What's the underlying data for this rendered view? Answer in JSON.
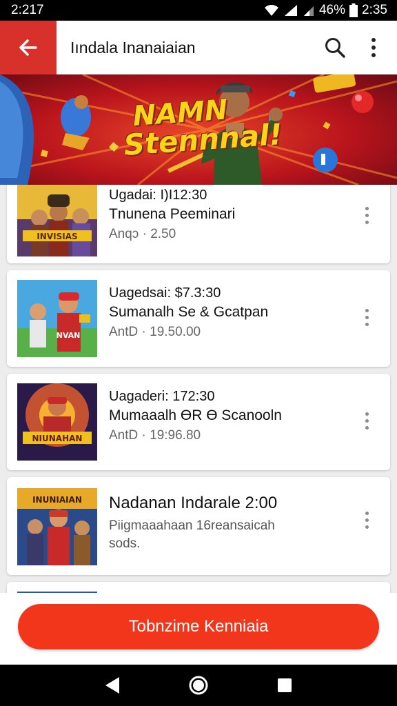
{
  "status_bar": {
    "time_left": "2:217",
    "battery": "46%",
    "time_right": "2:35"
  },
  "app_bar": {
    "title": "Iındala Inanaiaian",
    "icons": [
      "back-arrow-icon",
      "search-icon",
      "more-vert-icon"
    ]
  },
  "banner": {
    "title_line1": "NAMN",
    "title_line2": "Stennnal!"
  },
  "cards": [
    {
      "thumb_text": "INVISIAS",
      "line1": "Ugadai: I)I12:30",
      "line2": "Tnunena Peeminari",
      "line3": "Anqɔ · 2.50"
    },
    {
      "thumb_text": "NVAN",
      "line1": "Uagedsai: $7.3:30",
      "line2": "Sumanalh Se & Gcatpan",
      "line3": "AntD · 19.50.00"
    },
    {
      "thumb_text": "NIUNAHAN",
      "line1": "Uagaderi: 172:30",
      "line2": "Mumaaalh ƟR Ɵ Scanooln",
      "line3": "AntD · 19:96.80"
    },
    {
      "thumb_text": "INUNIAIAN",
      "headline": "Nadanan Indarale 2:00",
      "sub_line1": "Piigmaaahaan 16reansaicah",
      "sub_line2": "sods."
    }
  ],
  "cta": {
    "label": "Tobnzime Kenniaia"
  },
  "nav_bar": {
    "icons": [
      "back-triangle-icon",
      "home-circle-icon",
      "recents-square-icon"
    ]
  },
  "colors": {
    "accent": "#d8302a",
    "cta": "#f2361b",
    "banner_red": "#b8141c",
    "banner_yellow": "#ffd21c"
  }
}
